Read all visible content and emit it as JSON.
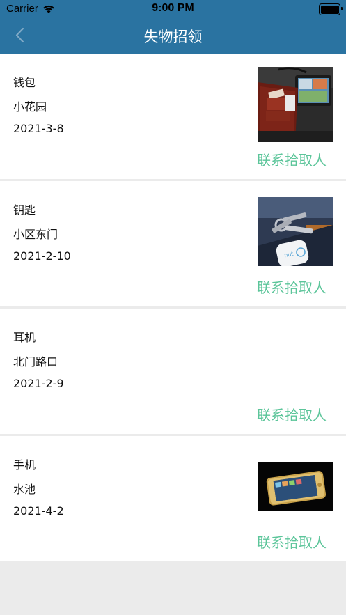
{
  "status_bar": {
    "carrier": "Carrier",
    "time": "9:00 PM"
  },
  "nav": {
    "title": "失物招领",
    "back_icon": "chevron-left-icon"
  },
  "colors": {
    "nav_background": "#2a73a1",
    "contact_link": "#5cc59a",
    "page_background": "#ebebeb"
  },
  "items": [
    {
      "name": "钱包",
      "location": "小花园",
      "date": "2021-3-8",
      "contact_label": "联系拾取人",
      "image": "wallet-photo"
    },
    {
      "name": "钥匙",
      "location": "小区东门",
      "date": "2021-2-10",
      "contact_label": "联系拾取人",
      "image": "keys-photo"
    },
    {
      "name": "耳机",
      "location": "北门路口",
      "date": "2021-2-9",
      "contact_label": "联系拾取人",
      "image": null
    },
    {
      "name": "手机",
      "location": "水池",
      "date": "2021-4-2",
      "contact_label": "联系拾取人",
      "image": "phone-photo"
    }
  ]
}
